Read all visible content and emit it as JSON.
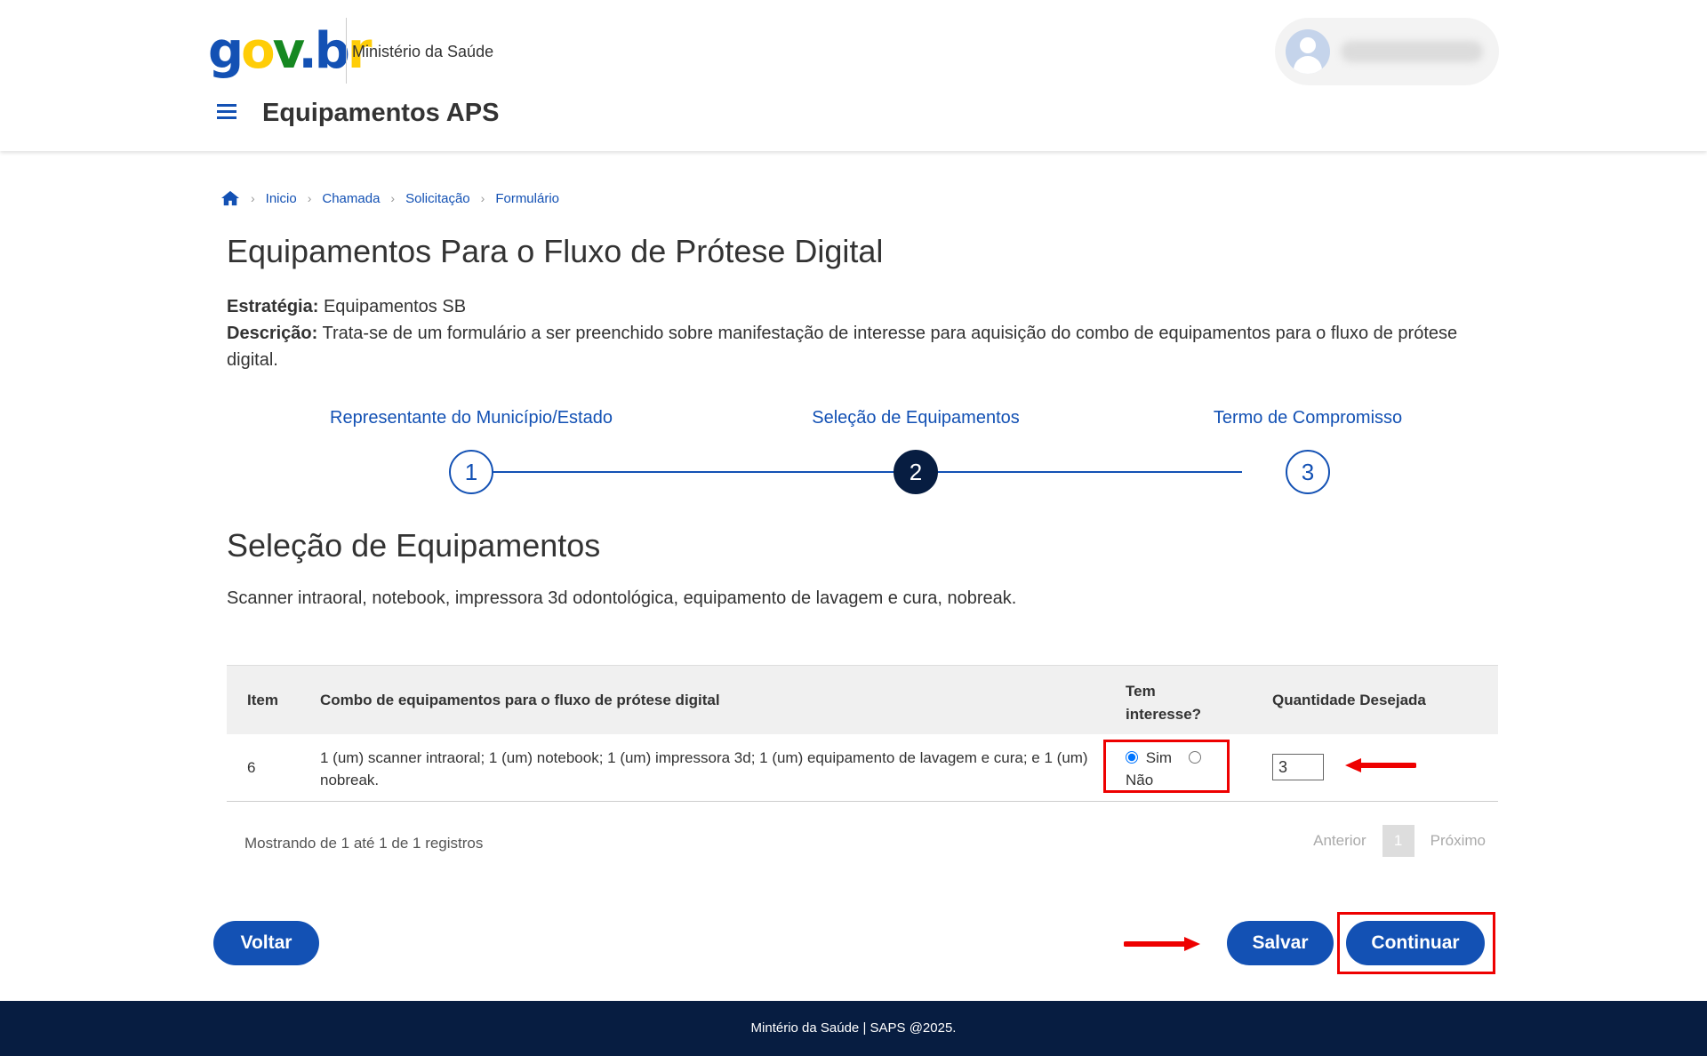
{
  "header": {
    "logo_letters": [
      "g",
      "o",
      "v",
      ".",
      "b",
      "r"
    ],
    "organization": "Ministério da Saúde",
    "app_title": "Equipamentos APS"
  },
  "breadcrumb": [
    "Inicio",
    "Chamada",
    "Solicitação",
    "Formulário"
  ],
  "page": {
    "title": "Equipamentos Para o Fluxo de Prótese Digital",
    "strategy_label": "Estratégia:",
    "strategy_value": "Equipamentos SB",
    "description_label": "Descrição:",
    "description_value": "Trata-se de um formulário a ser preenchido sobre manifestação de interesse para aquisição do combo de equipamentos para o fluxo de prótese digital."
  },
  "steps": [
    {
      "label": "Representante do Município/Estado",
      "number": "1",
      "active": false
    },
    {
      "label": "Seleção de Equipamentos",
      "number": "2",
      "active": true
    },
    {
      "label": "Termo de Compromisso",
      "number": "3",
      "active": false
    }
  ],
  "section": {
    "title": "Seleção de Equipamentos",
    "description": "Scanner intraoral, notebook, impressora 3d odontológica, equipamento de lavagem e cura, nobreak."
  },
  "table": {
    "headers": {
      "item": "Item",
      "combo": "Combo de equipamentos para o fluxo de prótese digital",
      "interest_line1": "Tem",
      "interest_line2": "interesse?",
      "quantity": "Quantidade Desejada"
    },
    "rows": [
      {
        "item": "6",
        "combo": "1 (um) scanner intraoral; 1 (um) notebook; 1 (um) impressora 3d; 1 (um) equipamento de lavagem e cura; e 1 (um) nobreak.",
        "yes_label": "Sim",
        "no_label": "Não",
        "selected": "Sim",
        "quantity": "3"
      }
    ],
    "showing": "Mostrando de 1 até 1 de 1 registros",
    "pager": {
      "previous": "Anterior",
      "page": "1",
      "next": "Próximo"
    }
  },
  "buttons": {
    "back": "Voltar",
    "save": "Salvar",
    "continue": "Continuar"
  },
  "annotation_color": "#e00000",
  "colors": {
    "primary": "#1351b4",
    "dark_blue": "#071d41"
  },
  "footer": "Mintério da Saúde | SAPS @2025."
}
